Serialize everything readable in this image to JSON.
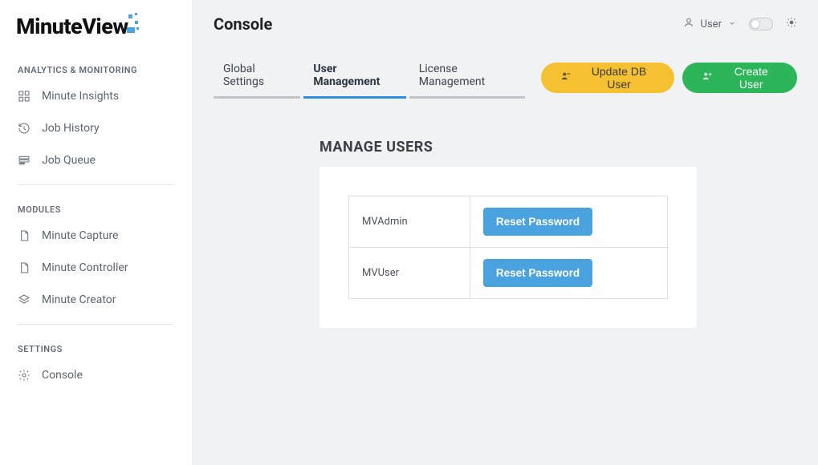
{
  "brand": {
    "part1": "Minute",
    "part2": "View"
  },
  "sidebar": {
    "sections": [
      {
        "title": "ANALYTICS & MONITORING",
        "items": [
          {
            "label": "Minute Insights",
            "name": "sidebar-item-minute-insights",
            "icon": "insights-icon"
          },
          {
            "label": "Job History",
            "name": "sidebar-item-job-history",
            "icon": "history-icon"
          },
          {
            "label": "Job Queue",
            "name": "sidebar-item-job-queue",
            "icon": "queue-icon"
          }
        ]
      },
      {
        "title": "MODULES",
        "items": [
          {
            "label": "Minute Capture",
            "name": "sidebar-item-minute-capture",
            "icon": "file-icon"
          },
          {
            "label": "Minute Controller",
            "name": "sidebar-item-minute-controller",
            "icon": "file-icon"
          },
          {
            "label": "Minute Creator",
            "name": "sidebar-item-minute-creator",
            "icon": "layers-icon"
          }
        ]
      },
      {
        "title": "SETTINGS",
        "items": [
          {
            "label": "Console",
            "name": "sidebar-item-console",
            "icon": "gear-icon"
          }
        ]
      }
    ]
  },
  "header": {
    "title": "Console",
    "user_label": "User"
  },
  "tabs": [
    {
      "label": "Global Settings",
      "name": "tab-global-settings",
      "active": false
    },
    {
      "label": "User Management",
      "name": "tab-user-management",
      "active": true
    },
    {
      "label": "License Management",
      "name": "tab-license-management",
      "active": false
    }
  ],
  "actions": {
    "update_db_user": "Update DB User",
    "create_user": "Create User"
  },
  "panel": {
    "heading": "MANAGE USERS",
    "reset_label": "Reset Password",
    "users": [
      {
        "name": "MVAdmin"
      },
      {
        "name": "MVUser"
      }
    ]
  },
  "colors": {
    "accent_blue": "#4aa3df",
    "tab_active": "#2f8de4",
    "btn_yellow": "#f5c032",
    "btn_green": "#2db559"
  }
}
